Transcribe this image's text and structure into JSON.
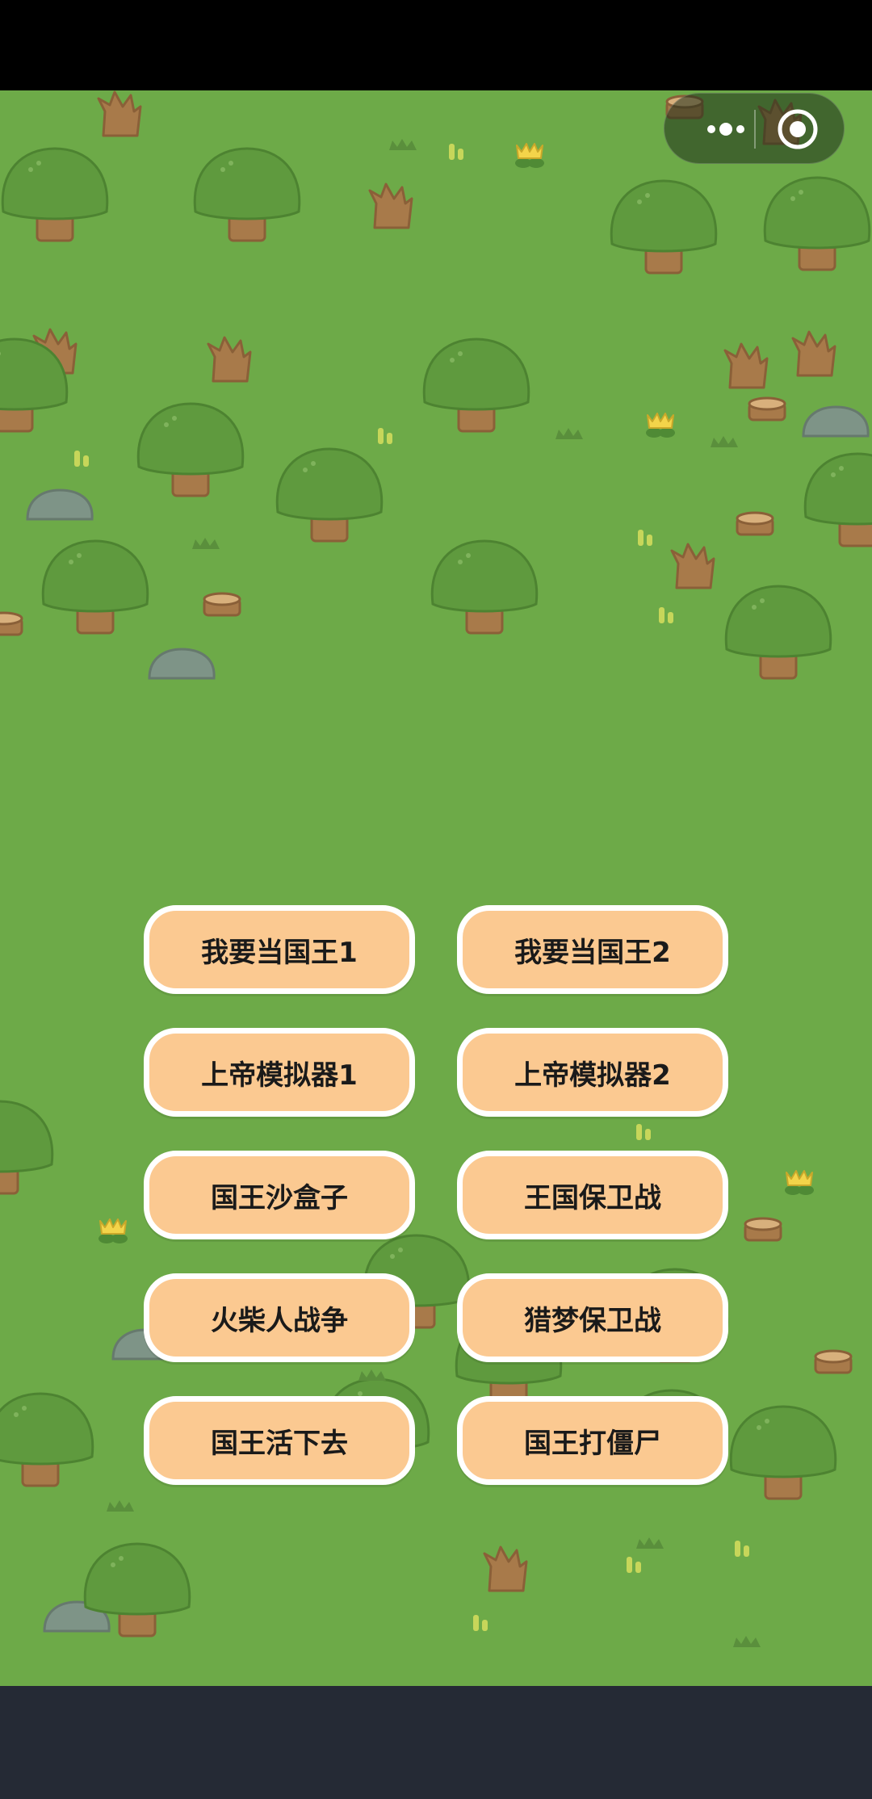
{
  "capsule": {
    "more_icon": "more-dots-icon",
    "close_icon": "target-close-icon"
  },
  "menu": {
    "buttons": [
      {
        "label": "我要当国王1"
      },
      {
        "label": "我要当国王2"
      },
      {
        "label": "上帝模拟器1"
      },
      {
        "label": "上帝模拟器2"
      },
      {
        "label": "国王沙盒子"
      },
      {
        "label": "王国保卫战"
      },
      {
        "label": "火柴人战争"
      },
      {
        "label": "猎梦保卫战"
      },
      {
        "label": "国王活下去"
      },
      {
        "label": "国王打僵尸"
      }
    ]
  },
  "colors": {
    "grass": "#6daa48",
    "button_fill": "#fbc991",
    "button_border": "#ffffff",
    "bottom_bar": "#252a35"
  }
}
